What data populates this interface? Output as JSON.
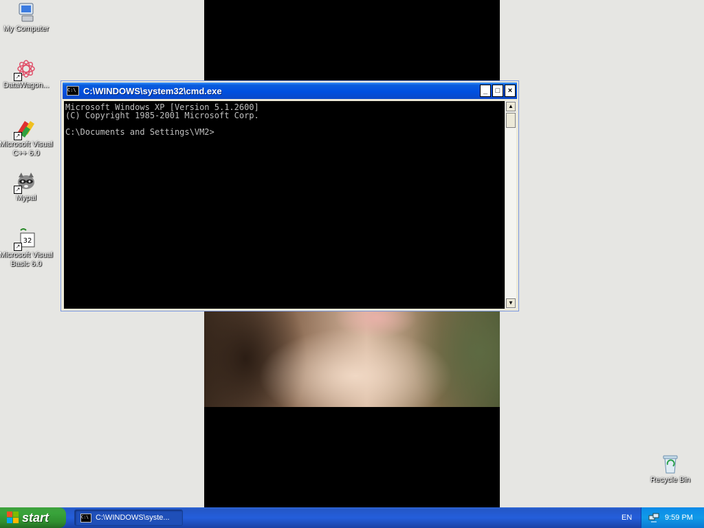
{
  "desktop": {
    "icons": [
      {
        "label": "My Computer",
        "icon": "my-computer-icon"
      },
      {
        "label": "DataWagon...",
        "icon": "datawagon-icon"
      },
      {
        "label": "Microsoft Visual C++ 6.0",
        "icon": "visual-cpp-icon"
      },
      {
        "label": "Mypal",
        "icon": "mypal-raccoon-icon"
      },
      {
        "label": "Microsoft Visual Basic 6.0",
        "icon": "visual-basic-icon"
      },
      {
        "label": "Recycle Bin",
        "icon": "recycle-bin-icon"
      }
    ]
  },
  "cmd": {
    "icon_text": "C:\\",
    "title": "C:\\WINDOWS\\system32\\cmd.exe",
    "buttons": {
      "minimize": "_",
      "maximize": "□",
      "close": "×"
    },
    "output": "Microsoft Windows XP [Version 5.1.2600]\n(C) Copyright 1985-2001 Microsoft Corp.\n\nC:\\Documents and Settings\\VM2>"
  },
  "taskbar": {
    "start_label": "start",
    "task_label": "C:\\WINDOWS\\syste...",
    "language": "EN",
    "clock": "9:59 PM"
  },
  "colors": {
    "title_bar": "#0050e0",
    "taskbar": "#245edb",
    "start": "#38a33a",
    "tray": "#109ae8"
  }
}
